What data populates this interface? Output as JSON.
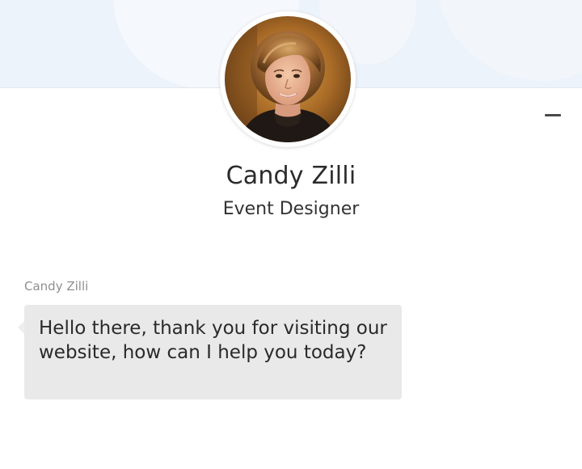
{
  "profile": {
    "name": "Candy Zilli",
    "title": "Event Designer",
    "avatar_icon": "person-photo"
  },
  "header": {
    "minimize_icon": "minus-icon"
  },
  "conversation": {
    "messages": [
      {
        "sender": "Candy Zilli",
        "text": "Hello there, thank you for visiting our website, how can I help you today?"
      }
    ]
  },
  "colors": {
    "header_background": "#edf3fa",
    "bubble_background": "#e9e9e9",
    "sender_label": "#8f8f8f",
    "text_dark": "#2b2b2b"
  }
}
